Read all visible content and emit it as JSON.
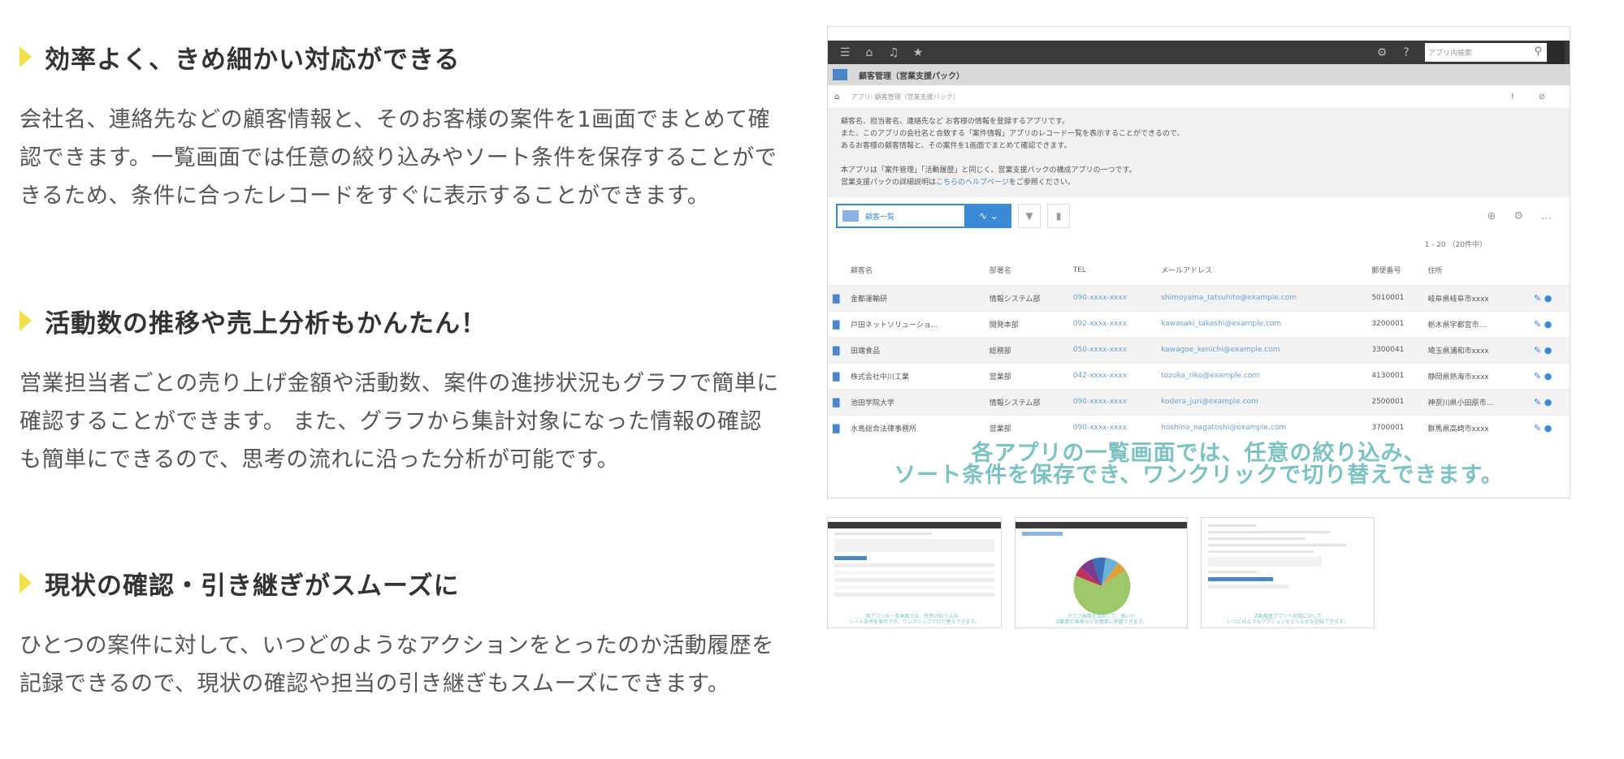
{
  "features": [
    {
      "title": "効率よく、きめ細かい対応ができる",
      "body": "会社名、連絡先などの顧客情報と、そのお客様の案件を1画面でまとめて確認できます。一覧画面では任意の絞り込みやソート条件を保存することができるため、条件に合ったレコードをすぐに表示することができます。"
    },
    {
      "title": "活動数の推移や売上分析もかんたん！",
      "body": "営業担当者ごとの売り上げ金額や活動数、案件の進捗状況もグラフで簡単に確認することができます。 また、グラフから集計対象になった情報の確認も簡単にできるので、思考の流れに沿った分析が可能です。"
    },
    {
      "title": "現状の確認・引き継ぎがスムーズに",
      "body": "ひとつの案件に対して、いつどのようなアクションをとったのか活動履歴を記録できるので、現状の確認や担当の引き継ぎもスムーズにできます。"
    }
  ],
  "screenshot": {
    "search_placeholder": "アプリ内検索",
    "app_title": "顧客管理（営業支援パック）",
    "breadcrumb": "アプリ: 顧客管理（営業支援パック）",
    "description": [
      "顧客名、担当者名、連絡先など お客様の情報を登録するアプリです。",
      "また、このアプリの会社名と合致する「案件情報」アプリのレコード一覧を表示することができるので、",
      "あるお客様の顧客情報と、その案件を1画面でまとめて確認できます。",
      "",
      "本アプリは「案件管理」「活動履歴」と同じく、営業支援パックの構成アプリの一つです。"
    ],
    "help_prefix": "営業支援パックの詳細説明は",
    "help_link": "こちらのヘルプページ",
    "help_suffix": "をご参照ください。",
    "view_name": "顧客一覧",
    "record_count": "1 - 20 （20件中）",
    "columns": [
      "顧客名",
      "部署名",
      "TEL",
      "メールアドレス",
      "郵便番号",
      "住所"
    ],
    "rows": [
      [
        "金都運輸研",
        "情報システム部",
        "090-xxxx-xxxx",
        "shimoyama_tatsuhito@example.com",
        "5010001",
        "岐阜県岐阜市xxxx"
      ],
      [
        "戸田ネットソリューショ…",
        "開発本部",
        "092-xxxx-xxxx",
        "kawasaki_takeshi@example.com",
        "3200001",
        "栃木県宇都宮市…"
      ],
      [
        "田端食品",
        "総務部",
        "050-xxxx-xxxx",
        "kawagoe_kenichi@example.com",
        "3300041",
        "埼玉県浦和市xxxx"
      ],
      [
        "株式会社中川工業",
        "営業部",
        "042-xxxx-xxxx",
        "tozuka_riko@example.com",
        "4130001",
        "静岡県熱海市xxxx"
      ],
      [
        "池田学院大学",
        "情報システム部",
        "090-xxxx-xxxx",
        "kodera_juri@example.com",
        "2500001",
        "神奈川県小田原市…"
      ],
      [
        "水島総合法律事務所",
        "営業部",
        "090-xxxx-xxxx",
        "hoshino_nagatoshi@example.com",
        "3700001",
        "群馬県高崎市xxxx"
      ]
    ],
    "overlay_line1": "各アプリの一覧画面では、任意の絞り込み、",
    "overlay_line2": "ソート条件を保存でき、ワンクリックで切り替えできます。"
  },
  "thumbnails": [
    {
      "caption1": "各アプリの一覧画面では、任意の絞り込み、",
      "caption2": "ソート条件を保存でき、ワンクリックで切り替えできます。"
    },
    {
      "caption1": "グラフ画面を活用して、高いか",
      "caption2": "活動数の推移などを簡単に把握できます。"
    },
    {
      "caption1": "活動履歴アプリで記録に対して",
      "caption2": "いつどのようなアクションをとったかを記録できます。"
    }
  ],
  "colors": {
    "heading_marker": "#f2e14b",
    "overlay_text": "#7dc2c2",
    "accent_blue": "#3b8ad6",
    "pie": [
      "#9ec76a",
      "#c2305a",
      "#7b3b8c",
      "#3f6fb4",
      "#e0a03b",
      "#6ab3d8",
      "#d3d3d3"
    ]
  }
}
